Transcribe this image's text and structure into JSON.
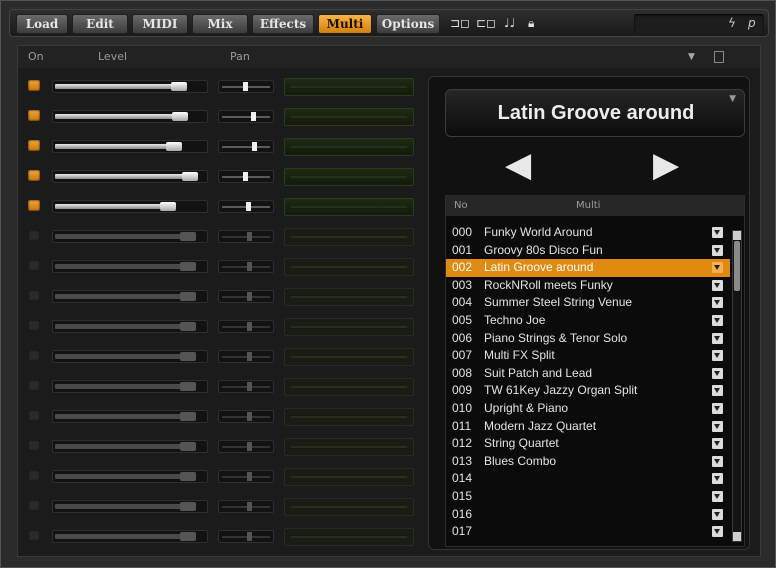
{
  "tabs": [
    {
      "label": "Load",
      "active": false
    },
    {
      "label": "Edit",
      "active": false
    },
    {
      "label": "MIDI",
      "active": false
    },
    {
      "label": "Mix",
      "active": false
    },
    {
      "label": "Effects",
      "active": false
    },
    {
      "label": "Multi",
      "active": true
    },
    {
      "label": "Options",
      "active": false
    }
  ],
  "toolbar_icons": [
    "split-out-icon",
    "split-in-icon",
    "note-icon",
    "lock-icon"
  ],
  "status_icons": {
    "activity": "ϟ",
    "parameter": "p"
  },
  "columns": {
    "on": "On",
    "level": "Level",
    "pan": "Pan"
  },
  "slots": [
    {
      "on": true,
      "level": 0.88,
      "pan": 0.45
    },
    {
      "on": true,
      "level": 0.89,
      "pan": 0.62
    },
    {
      "on": true,
      "level": 0.84,
      "pan": 0.65
    },
    {
      "on": true,
      "level": 0.96,
      "pan": 0.45
    },
    {
      "on": true,
      "level": 0.8,
      "pan": 0.52
    },
    {
      "on": false,
      "level": 0.95,
      "pan": 0.55
    },
    {
      "on": false,
      "level": 0.95,
      "pan": 0.55
    },
    {
      "on": false,
      "level": 0.95,
      "pan": 0.55
    },
    {
      "on": false,
      "level": 0.95,
      "pan": 0.55
    },
    {
      "on": false,
      "level": 0.95,
      "pan": 0.55
    },
    {
      "on": false,
      "level": 0.95,
      "pan": 0.55
    },
    {
      "on": false,
      "level": 0.95,
      "pan": 0.55
    },
    {
      "on": false,
      "level": 0.95,
      "pan": 0.55
    },
    {
      "on": false,
      "level": 0.95,
      "pan": 0.55
    },
    {
      "on": false,
      "level": 0.95,
      "pan": 0.55
    },
    {
      "on": false,
      "level": 0.95,
      "pan": 0.55
    }
  ],
  "current_multi": "Latin Groove around",
  "nav": {
    "prev": "◀",
    "next": "▶"
  },
  "list_header": {
    "no": "No",
    "name": "Multi"
  },
  "multis": [
    {
      "no": "000",
      "name": "Funky World Around",
      "selected": false
    },
    {
      "no": "001",
      "name": "Groovy 80s Disco Fun",
      "selected": false
    },
    {
      "no": "002",
      "name": "Latin Groove around",
      "selected": true
    },
    {
      "no": "003",
      "name": "RockNRoll meets Funky",
      "selected": false
    },
    {
      "no": "004",
      "name": "Summer Steel String Venue",
      "selected": false
    },
    {
      "no": "005",
      "name": "Techno Joe",
      "selected": false
    },
    {
      "no": "006",
      "name": "Piano Strings & Tenor Solo",
      "selected": false
    },
    {
      "no": "007",
      "name": "Multi FX Split",
      "selected": false
    },
    {
      "no": "008",
      "name": "Suit Patch and Lead",
      "selected": false
    },
    {
      "no": "009",
      "name": "TW 61Key Jazzy Organ Split",
      "selected": false
    },
    {
      "no": "010",
      "name": "Upright & Piano",
      "selected": false
    },
    {
      "no": "011",
      "name": "Modern Jazz Quartet",
      "selected": false
    },
    {
      "no": "012",
      "name": "String Quartet",
      "selected": false
    },
    {
      "no": "013",
      "name": "Blues Combo",
      "selected": false
    },
    {
      "no": "014",
      "name": "",
      "selected": false
    },
    {
      "no": "015",
      "name": "",
      "selected": false
    },
    {
      "no": "016",
      "name": "",
      "selected": false
    },
    {
      "no": "017",
      "name": "",
      "selected": false
    }
  ],
  "colors": {
    "accent": "#e08a12",
    "background": "#1b1b1b"
  }
}
